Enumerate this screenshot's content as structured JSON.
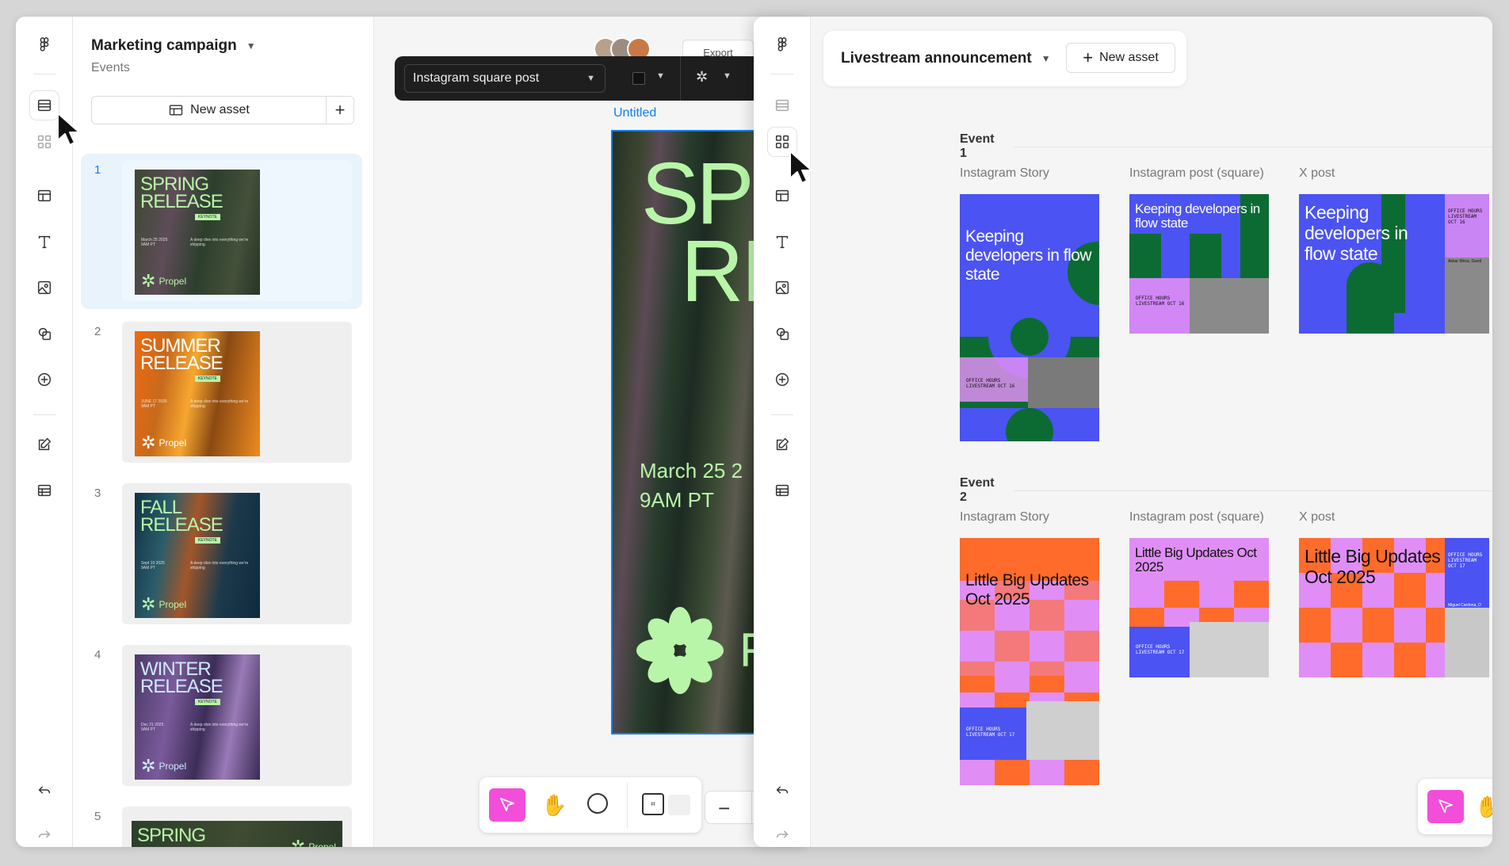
{
  "left_window": {
    "project": {
      "title": "Marketing campaign",
      "subtitle": "Events"
    },
    "new_asset_label": "New asset",
    "pages": [
      {
        "num": "1",
        "line1": "SPRING",
        "line2": "RELEASE",
        "date": "March 25 2025\n9AM PT",
        "bg": "linear-gradient(100deg,#3c4832,#5e4c58 30%,#2c3f2c 55%,#44503a 80%,#283426)",
        "text_color": "#b8f5a8"
      },
      {
        "num": "2",
        "line1": "SUMMER",
        "line2": "RELEASE",
        "date": "JUNE 17 2025\n9AM PT",
        "bg": "linear-gradient(100deg,#f06a10,#c66a1c 25%,#f7a72f 45%,#8a4a12 65%,#f08b20)",
        "text_color": "#ffffff"
      },
      {
        "num": "3",
        "line1": "FALL",
        "line2": "RELEASE",
        "date": "Sept 10 2025\n9AM PT",
        "bg": "linear-gradient(100deg,#103244,#2b5d6a 25%,#a2562a 45%,#1c3a4c 70%,#0f2a3c)",
        "text_color": "#b8f5a8"
      },
      {
        "num": "4",
        "line1": "WINTER",
        "line2": "RELEASE",
        "date": "Dec 21 2025\n9AM PT",
        "bg": "linear-gradient(100deg,#4b3a6a,#7a5a9a 30%,#3c2d58 55%,#9a7ab8 75%,#3a2a54)",
        "text_color": "#cfe9ff"
      },
      {
        "num": "5",
        "line1": "SPRING",
        "line2": "",
        "date": "",
        "bg": "linear-gradient(100deg,#2c3f2c,#3f4b32,#2a3a28)",
        "text_color": "#b8f5a8"
      }
    ],
    "badge": "KEYNOTE",
    "blurb": "A deep dive into everything we're shipping",
    "brand": "Propel",
    "toolbar": {
      "format": "Instagram square post"
    },
    "share_label": "Export",
    "frame": {
      "label": "Untitled",
      "line1": "SP",
      "line2": "RI",
      "date_l1": "March 25 2",
      "date_l2": "9AM PT",
      "brand": "F"
    }
  },
  "right_window": {
    "title": "Livestream announcement",
    "new_asset_label": "New asset",
    "events": [
      {
        "name": "Event 1",
        "assets": [
          {
            "label": "Instagram Story",
            "headline": "Keeping developers in flow state",
            "tag": "OFFICE HOURS LIVESTREAM OCT 16"
          },
          {
            "label": "Instagram post (square)",
            "headline": "Keeping developers in flow state",
            "tag": "OFFICE HOURS LIVESTREAM OCT 16"
          },
          {
            "label": "X post",
            "headline": "Keeping developers in flow state",
            "tag": "OFFICE HOURS LIVESTREAM OCT 16",
            "byline": "Akbar Mirza, David"
          }
        ]
      },
      {
        "name": "Event 2",
        "assets": [
          {
            "label": "Instagram Story",
            "headline": "Little Big Updates Oct 2025",
            "tag": "OFFICE HOURS LIVESTREAM OCT 17"
          },
          {
            "label": "Instagram post (square)",
            "headline": "Little Big Updates Oct 2025",
            "tag": "OFFICE HOURS LIVESTREAM OCT 17"
          },
          {
            "label": "X post",
            "headline": "Little Big Updates Oct 2025",
            "tag": "OFFICE HOURS LIVESTREAM OCT 17",
            "byline": "Miguel Cardona, D"
          }
        ]
      }
    ]
  },
  "colors": {
    "accent_blue": "#0d7ff2",
    "tool_pink": "#f24ed9",
    "event1_blue": "#4b53f2",
    "event1_green": "#0c6b33",
    "event2_orange": "#ff6b2b",
    "event2_pink": "#e08ef5",
    "spring_green": "#b8f5a8"
  },
  "icons": [
    "figma-logo-icon",
    "layers-icon",
    "grid-icon",
    "layout-icon",
    "text-icon",
    "image-icon",
    "shapes-icon",
    "add-circle-icon",
    "edit-icon",
    "table-icon",
    "undo-icon",
    "redo-icon",
    "cursor-icon",
    "hand-icon",
    "comment-icon",
    "minus-icon",
    "plus-icon",
    "chevron-down-icon",
    "magic-wand-icon"
  ]
}
